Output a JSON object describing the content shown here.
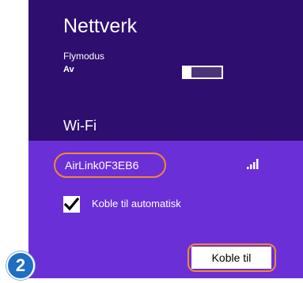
{
  "header": {
    "title": "Nettverk"
  },
  "airplane_mode": {
    "label": "Flymodus",
    "state": "Av"
  },
  "wifi": {
    "heading": "Wi-Fi",
    "network": {
      "name": "AirLink0F3EB6",
      "icon": "wifi-signal-icon"
    },
    "auto_connect": {
      "label": "Koble til automatisk",
      "checked": true
    },
    "connect_button": "Koble til"
  },
  "annotation": {
    "step_number": "2"
  },
  "colors": {
    "header_bg": "#2e0e6e",
    "network_bg": "#6b2fd8",
    "highlight": "#f08a30",
    "badge": "#1f6ec3"
  }
}
